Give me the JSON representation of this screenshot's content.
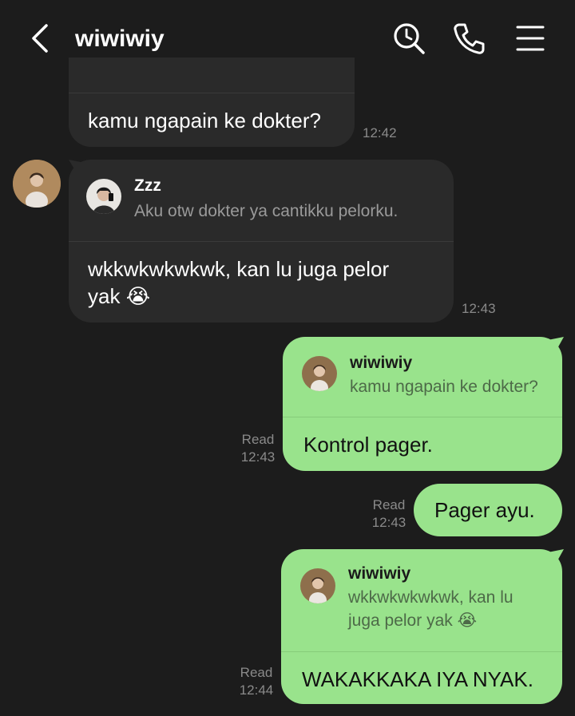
{
  "header": {
    "title": "wiwiwiy",
    "icons": [
      "back-icon",
      "search-icon",
      "phone-icon",
      "menu-icon"
    ]
  },
  "messages": [
    {
      "text": "kamu ngapain ke dokter?",
      "time": "12:42"
    },
    {
      "reply_name": "Zzz",
      "reply_text": "Aku otw dokter ya cantikku pelorku.",
      "text_line1": "wkkwkwkwkwk, kan lu juga pelor",
      "text_line2": "yak",
      "emoji": "😭",
      "time": "12:43"
    },
    {
      "reply_name": "wiwiwiy",
      "reply_text": "kamu ngapain ke dokter?",
      "text": "Kontrol pager.",
      "status": "Read",
      "time": "12:43"
    },
    {
      "text": "Pager ayu.",
      "status": "Read",
      "time": "12:43"
    },
    {
      "reply_name": "wiwiwiy",
      "reply_line1": "wkkwkwkwkwk, kan lu",
      "reply_line2": "juga pelor yak",
      "reply_emoji": "😭",
      "text": "WAKAKKAKA IYA NYAK.",
      "status": "Read",
      "time": "12:44"
    }
  ],
  "colors": {
    "background": "#1c1c1c",
    "incoming_bubble": "#2a2a2a",
    "outgoing_bubble": "#99e38c",
    "timestamp": "#8a8a8a"
  }
}
